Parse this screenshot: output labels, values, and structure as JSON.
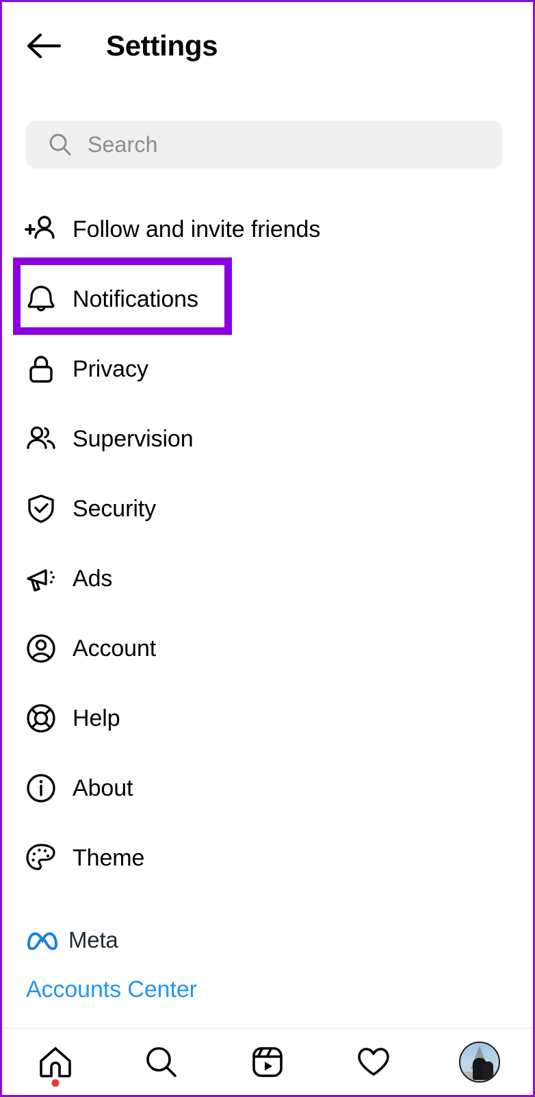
{
  "header": {
    "back_icon": "back-arrow-icon",
    "title": "Settings"
  },
  "search": {
    "icon": "search-icon",
    "placeholder": "Search",
    "value": ""
  },
  "settings_list": [
    {
      "label": "Follow and invite friends",
      "icon": "person-add-icon",
      "highlighted": false
    },
    {
      "label": "Notifications",
      "icon": "bell-icon",
      "highlighted": true
    },
    {
      "label": "Privacy",
      "icon": "lock-icon",
      "highlighted": false
    },
    {
      "label": "Supervision",
      "icon": "people-icon",
      "highlighted": false
    },
    {
      "label": "Security",
      "icon": "shield-check-icon",
      "highlighted": false
    },
    {
      "label": "Ads",
      "icon": "megaphone-icon",
      "highlighted": false
    },
    {
      "label": "Account",
      "icon": "account-circle-icon",
      "highlighted": false
    },
    {
      "label": "Help",
      "icon": "life-ring-icon",
      "highlighted": false
    },
    {
      "label": "About",
      "icon": "info-circle-icon",
      "highlighted": false
    },
    {
      "label": "Theme",
      "icon": "palette-icon",
      "highlighted": false
    }
  ],
  "meta": {
    "logo_icon": "meta-infinity-icon",
    "brand": "Meta",
    "accounts_center_label": "Accounts Center"
  },
  "bottom_nav": [
    {
      "name": "home",
      "icon": "home-icon",
      "badge": true
    },
    {
      "name": "search",
      "icon": "search-icon",
      "badge": false
    },
    {
      "name": "reels",
      "icon": "reels-icon",
      "badge": false
    },
    {
      "name": "activity",
      "icon": "heart-icon",
      "badge": false
    },
    {
      "name": "profile",
      "icon": "avatar-icon",
      "badge": false
    }
  ],
  "colors": {
    "highlight_purple": "#8A00E0",
    "link_blue": "#1F97F2",
    "meta_logo_blue": "#1B7FE3",
    "search_bg": "#EFEFEF",
    "placeholder_gray": "#8C8C8C",
    "badge_red": "#E8383D"
  }
}
